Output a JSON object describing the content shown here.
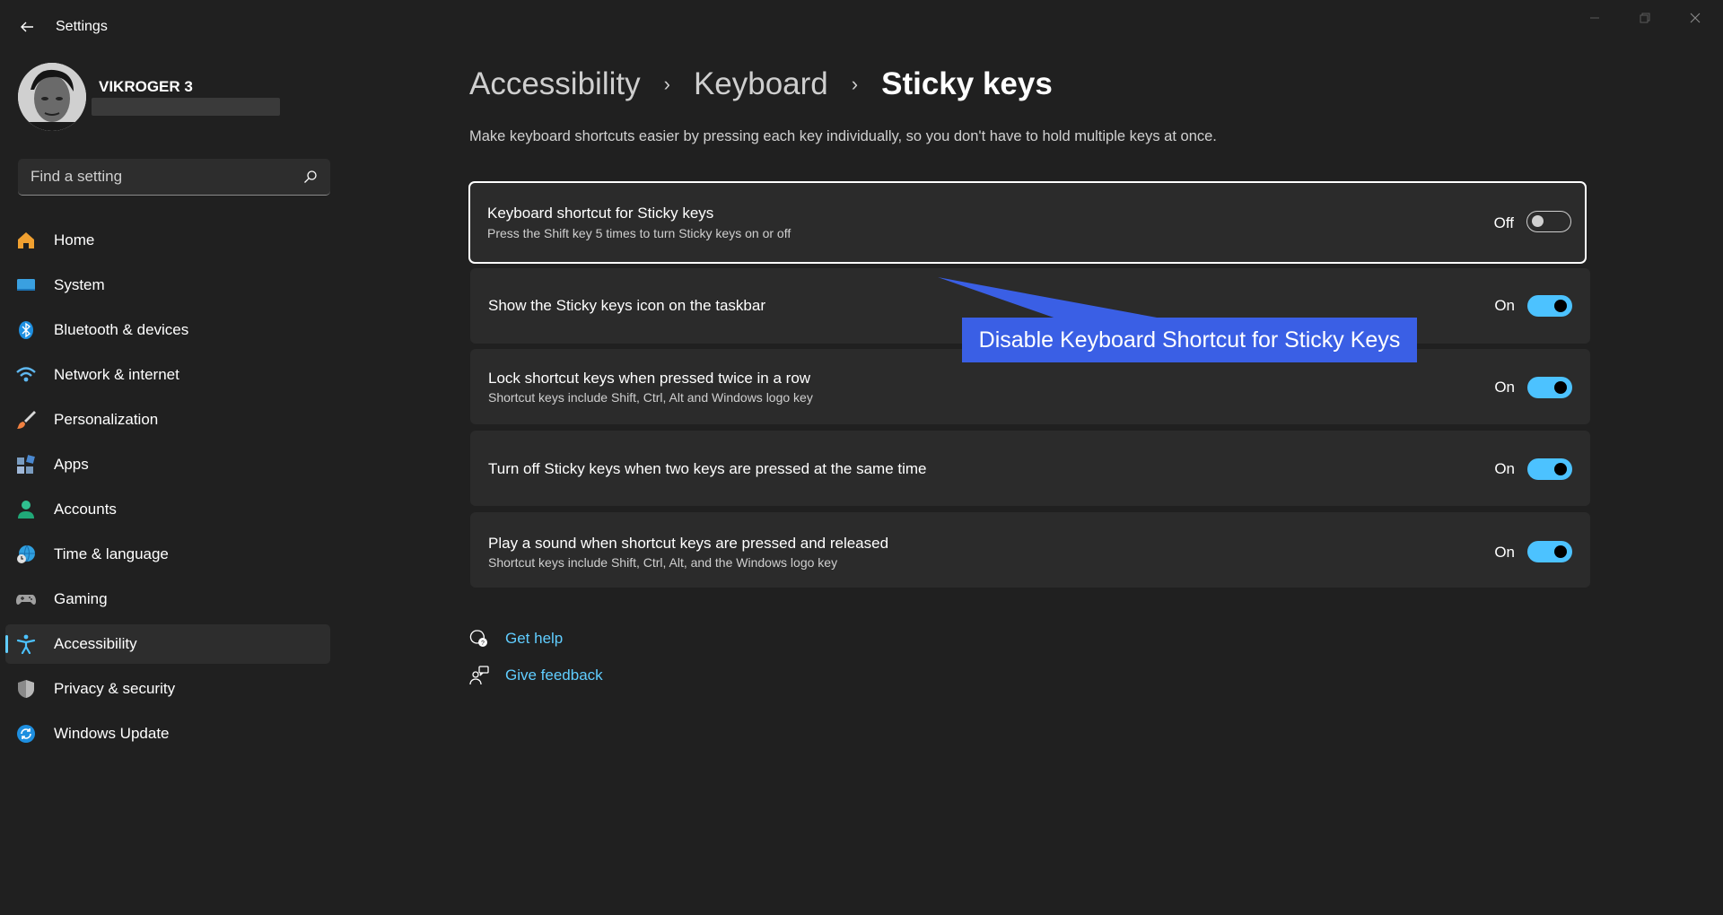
{
  "window": {
    "title": "Settings"
  },
  "user": {
    "name": "VIKROGER 3"
  },
  "search": {
    "placeholder": "Find a setting"
  },
  "sidebar": {
    "items": [
      {
        "label": "Home",
        "icon": "home-icon",
        "color": "#f0a030"
      },
      {
        "label": "System",
        "icon": "system-icon",
        "color": "#3aa0e0"
      },
      {
        "label": "Bluetooth & devices",
        "icon": "bluetooth-icon",
        "color": "#1e8fe0"
      },
      {
        "label": "Network & internet",
        "icon": "wifi-icon",
        "color": "#5fb8f0"
      },
      {
        "label": "Personalization",
        "icon": "brush-icon",
        "color": "#f08040"
      },
      {
        "label": "Apps",
        "icon": "apps-icon",
        "color": "#7a9cc0"
      },
      {
        "label": "Accounts",
        "icon": "accounts-icon",
        "color": "#30c090"
      },
      {
        "label": "Time & language",
        "icon": "globe-clock-icon",
        "color": "#30a0e0"
      },
      {
        "label": "Gaming",
        "icon": "gamepad-icon",
        "color": "#a0a0a0"
      },
      {
        "label": "Accessibility",
        "icon": "accessibility-icon",
        "color": "#4cc2ff",
        "active": true
      },
      {
        "label": "Privacy & security",
        "icon": "shield-icon",
        "color": "#8a8a8a"
      },
      {
        "label": "Windows Update",
        "icon": "update-icon",
        "color": "#1e8fe0"
      }
    ]
  },
  "breadcrumb": {
    "items": [
      "Accessibility",
      "Keyboard"
    ],
    "current": "Sticky keys",
    "separator": "›"
  },
  "description": "Make keyboard shortcuts easier by pressing each key individually, so you don't have to hold multiple keys at once.",
  "settings": [
    {
      "title": "Keyboard shortcut for Sticky keys",
      "subtitle": "Press the Shift key 5 times to turn Sticky keys on or off",
      "state_label": "Off",
      "on": false
    },
    {
      "title": "Show the Sticky keys icon on the taskbar",
      "subtitle": "",
      "state_label": "On",
      "on": true
    },
    {
      "title": "Lock shortcut keys when pressed twice in a row",
      "subtitle": "Shortcut keys include Shift, Ctrl, Alt and Windows logo key",
      "state_label": "On",
      "on": true
    },
    {
      "title": "Turn off Sticky keys when two keys are pressed at the same time",
      "subtitle": "",
      "state_label": "On",
      "on": true
    },
    {
      "title": "Play a sound when shortcut keys are pressed and released",
      "subtitle": "Shortcut keys include Shift, Ctrl, Alt, and the Windows logo key",
      "state_label": "On",
      "on": true
    }
  ],
  "help": {
    "get_help": "Get help",
    "give_feedback": "Give feedback"
  },
  "annotation": {
    "text": "Disable Keyboard Shortcut for Sticky Keys",
    "color": "#3a5fe5"
  },
  "colors": {
    "background": "#202020",
    "card": "#2b2b2b",
    "accent": "#4cc2ff",
    "link": "#60cdff"
  }
}
